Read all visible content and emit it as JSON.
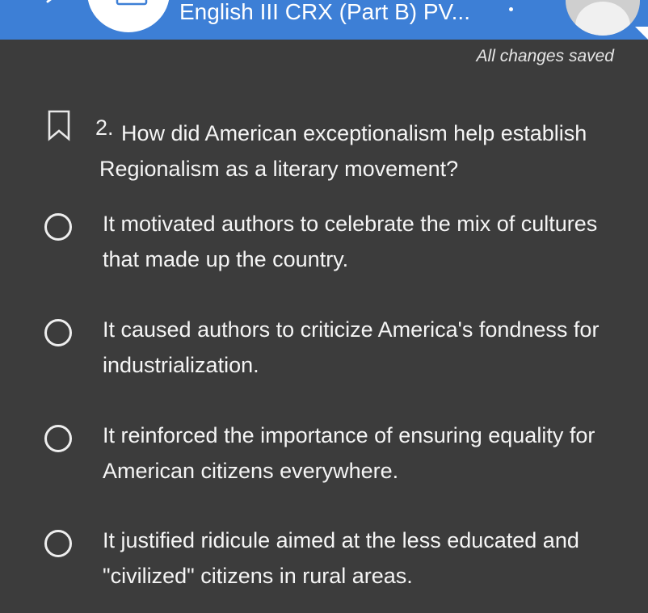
{
  "header": {
    "title": "English III CRX (Part B) PV..."
  },
  "status": {
    "saved_text": "All changes saved"
  },
  "question": {
    "number": "2.",
    "text": "How did American exceptionalism help establish Regionalism as a literary movement?"
  },
  "options": [
    {
      "text": "It motivated authors to celebrate the mix of cultures that made up the country."
    },
    {
      "text": "It caused authors to criticize America's fondness for industrialization."
    },
    {
      "text": "It reinforced the importance of ensuring equality for American citizens everywhere."
    },
    {
      "text": "It justified ridicule aimed at the less educated and \"civilized\" citizens in rural areas."
    }
  ],
  "colors": {
    "header_bg": "#3d7fd6",
    "page_bg": "#3c3c3c",
    "text": "#f5f5f5"
  },
  "icons": {
    "back": "chevron-left-icon",
    "bookmark": "bookmark-outline-icon",
    "radio": "radio-unchecked-icon",
    "avatar": "user-avatar-icon",
    "menu": "more-dot-icon"
  }
}
